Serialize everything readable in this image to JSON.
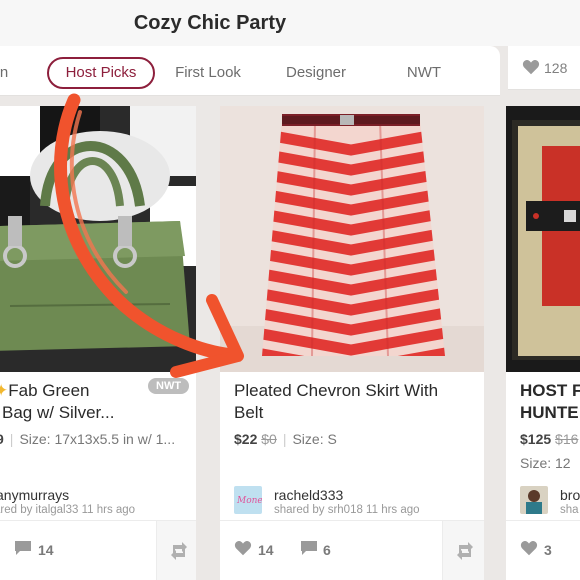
{
  "header": {
    "title": "Cozy Chic Party"
  },
  "tabs": [
    {
      "label": "n",
      "active": false
    },
    {
      "label": "Host Picks",
      "active": true
    },
    {
      "label": "First Look",
      "active": false
    },
    {
      "label": "Designer",
      "active": false
    },
    {
      "label": "NWT",
      "active": false
    }
  ],
  "right_likes": {
    "count": "128",
    "icon": "heart-icon"
  },
  "cards": [
    {
      "title_line1": "Fab Green",
      "title_line2": "Bag w/ Silver...",
      "badge": "NWT",
      "price_prefix": "9",
      "size": "Size: 17x13x5.5 in w/ 1...",
      "user": "anymurrays",
      "shared": "ared by italgal33 11 hrs ago",
      "comments": "14"
    },
    {
      "title_line1": "Pleated Chevron Skirt With",
      "title_line2": "Belt",
      "price": "$22",
      "original_price": "$0",
      "size": "Size: S",
      "user": "racheld333",
      "shared": "shared by srh018 11 hrs ago",
      "likes": "14",
      "comments": "6"
    },
    {
      "title_line1": "HOST F",
      "title_line2": "HUNTE",
      "price": "$125",
      "original_price": "$16",
      "size": "Size: 12",
      "user": "bro",
      "shared": "sha",
      "likes": "3"
    }
  ],
  "colors": {
    "accent": "#8d1f3c",
    "arrow": "#f0532d",
    "chevron_red": "#e23a36"
  }
}
